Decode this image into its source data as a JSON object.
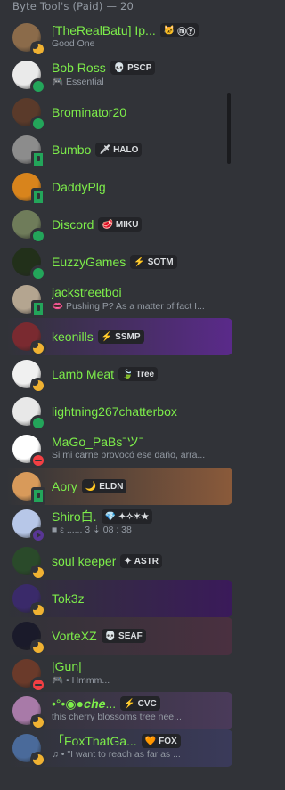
{
  "header": {
    "title": "Byte Tool's (Paid) — 20"
  },
  "members": [
    {
      "name": "[TheRealBatu] Ip...",
      "tag": "ⓜⓨ",
      "tag_icon": "cat",
      "sub": "Good One",
      "status": "idle",
      "avatar": "#8b6b4a",
      "style": "double",
      "banner": false
    },
    {
      "name": "Bob Ross",
      "tag": "PSCP",
      "tag_icon": "skull",
      "sub": "🎮 Essential",
      "status": "online",
      "avatar": "#eaeaea",
      "style": "double",
      "banner": false
    },
    {
      "name": "Brominator20",
      "tag": "",
      "sub": "",
      "status": "online",
      "avatar": "#5a3a2a",
      "style": "single",
      "banner": false
    },
    {
      "name": "Bumbo",
      "tag": "HALO",
      "tag_icon": "sword",
      "sub": "",
      "status": "mobile",
      "avatar": "#8c8c8c",
      "style": "single",
      "banner": false
    },
    {
      "name": "DaddyPlg",
      "tag": "",
      "sub": "",
      "status": "mobile",
      "avatar": "#d8841c",
      "style": "single",
      "banner": false
    },
    {
      "name": "Discord",
      "tag": "MIKU",
      "tag_icon": "ham",
      "sub": "",
      "status": "online",
      "avatar": "#6f7c5a",
      "style": "single",
      "banner": false
    },
    {
      "name": "EuzzyGames",
      "tag": "SOTM",
      "tag_icon": "bolt",
      "sub": "",
      "status": "online",
      "avatar": "#22301a",
      "style": "single",
      "banner": false
    },
    {
      "name": "jackstreetboi",
      "tag": "",
      "sub": "👄 Pushing P? As a matter of fact I...",
      "status": "mobile",
      "avatar": "#b4a590",
      "style": "double",
      "banner": false
    },
    {
      "name": "keonills",
      "tag": "SSMP",
      "tag_icon": "bolt",
      "sub": "",
      "status": "idle",
      "avatar": "#7a2a30",
      "style": "single",
      "banner": true,
      "banner_color": "#5a2a8a"
    },
    {
      "name": "Lamb Meat",
      "tag": "Tree",
      "tag_icon": "leaf",
      "sub": "",
      "status": "idle",
      "avatar": "#f0f0f0",
      "style": "single",
      "banner": false
    },
    {
      "name": "lightning267chatterbox",
      "tag": "",
      "sub": "",
      "status": "online",
      "avatar": "#e8e8e8",
      "style": "single",
      "banner": false
    },
    {
      "name": "MaGo_PaBsˉツˉ",
      "tag": "",
      "sub": "Si mi carne provocó ese daño, arra...",
      "status": "dnd",
      "avatar": "#ffffff",
      "style": "double",
      "banner": false
    },
    {
      "name": "Aory",
      "tag": "ELDN",
      "tag_icon": "moon",
      "sub": "",
      "status": "mobile",
      "avatar": "#d89a5a",
      "style": "single",
      "banner": true,
      "banner_color": "#8a5a3a"
    },
    {
      "name": "Shiro白.",
      "tag": "✦✧✶★",
      "tag_icon": "gem",
      "sub": "■ ε ...... 3 ⇣ 08 : 38",
      "status": "stream",
      "avatar": "#b7c7e8",
      "style": "double",
      "banner": false
    },
    {
      "name": "soul keeper",
      "tag": "ASTR",
      "tag_icon": "star4",
      "sub": "",
      "status": "idle",
      "avatar": "#2a4a2a",
      "style": "single",
      "banner": false
    },
    {
      "name": "Tok3z",
      "tag": "",
      "sub": "",
      "status": "idle",
      "avatar": "#3a2a6a",
      "style": "single",
      "banner": true,
      "banner_color": "#3a1a5a"
    },
    {
      "name": "VorteXZ",
      "tag": "SEAF",
      "tag_icon": "skull",
      "sub": "",
      "status": "idle",
      "avatar": "#1a1a2a",
      "style": "single",
      "banner": true,
      "banner_color": "#4a3040"
    },
    {
      "name": "|Gun|",
      "tag": "",
      "sub": "🎮 • Hmmm...",
      "status": "dnd",
      "avatar": "#6a3a2a",
      "style": "double",
      "banner": false
    },
    {
      "name": "•°•◉●𝒄𝒉𝒆...",
      "tag": "CVC",
      "tag_icon": "bolt",
      "sub": "this cherry blossoms tree nee...",
      "status": "idle",
      "avatar": "#a87aa8",
      "style": "double",
      "banner": true,
      "banner_color": "#4a3a5a"
    },
    {
      "name": "「FoxThatGa...",
      "tag": "FOX",
      "tag_icon": "heart",
      "sub": "♫ • \"I want to reach as far as ...",
      "status": "idle",
      "avatar": "#4a6a9a",
      "style": "double",
      "banner": true,
      "banner_color": "#3a3a5a"
    }
  ],
  "colors": {
    "online": "#23a55a",
    "idle": "#f0b232",
    "dnd": "#f23f43",
    "mobile": "#23a55a",
    "stream": "#593695",
    "name": "#7ded4a"
  }
}
